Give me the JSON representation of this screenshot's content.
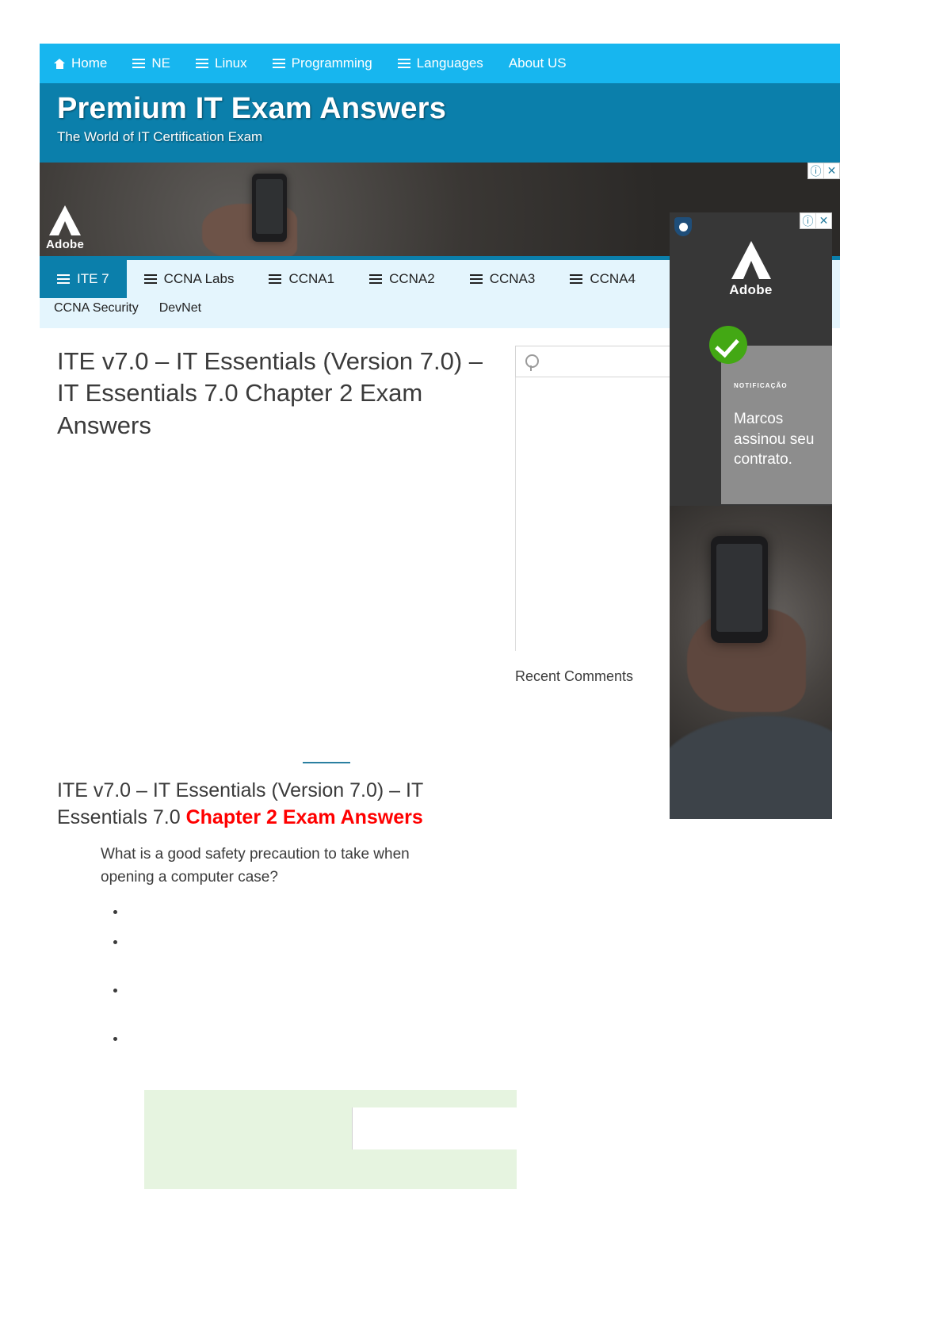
{
  "topnav": {
    "items": [
      {
        "label": "Home",
        "icon": "home-icon"
      },
      {
        "label": "NE",
        "icon": "hamburger-icon"
      },
      {
        "label": "Linux",
        "icon": "hamburger-icon"
      },
      {
        "label": "Programming",
        "icon": "hamburger-icon"
      },
      {
        "label": "Languages",
        "icon": "hamburger-icon"
      },
      {
        "label": "About US",
        "icon": "none"
      }
    ]
  },
  "header": {
    "title": "Premium IT Exam Answers",
    "tagline": "The World of IT Certification Exam"
  },
  "ads": {
    "leaderboard": {
      "brand": "Adobe",
      "info_icon": "ⓘ",
      "close_icon": "✕"
    },
    "square": {
      "brand": "Adobe",
      "info_icon": "ⓘ",
      "close_icon": "✕",
      "notification_label": "NOTIFICAÇÃO",
      "notification_text": "Marcos assinou seu contrato."
    }
  },
  "coursenav": {
    "row1": [
      {
        "label": "ITE 7",
        "active": true
      },
      {
        "label": "CCNA Labs",
        "active": false
      },
      {
        "label": "CCNA1",
        "active": false
      },
      {
        "label": "CCNA2",
        "active": false
      },
      {
        "label": "CCNA3",
        "active": false
      },
      {
        "label": "CCNA4",
        "active": false
      }
    ],
    "row2": [
      {
        "label": "CCNA Security"
      },
      {
        "label": "DevNet"
      }
    ]
  },
  "article": {
    "post_title": "ITE v7.0 – IT Essentials (Version 7.0) – IT Essentials 7.0 Chapter 2 Exam Answers",
    "entry_heading_plain": "ITE v7.0 – IT Essentials (Version 7.0) – IT Essentials 7.0 ",
    "entry_heading_highlight": "Chapter 2 Exam Answers",
    "question": "What is a good safety precaution to take when opening a computer case?",
    "answers": [
      "",
      "",
      "",
      ""
    ]
  },
  "sidebar": {
    "search_value": "",
    "search_placeholder": "",
    "recent_comments_title": "Recent Comments"
  },
  "colors": {
    "topnav": "#17b6ef",
    "header": "#0b7fab",
    "coursenav_bg": "#e4f5fd",
    "accent": "#0b7fab",
    "highlight_red": "#ff0000",
    "explain_green": "#e6f4e0",
    "check_green": "#43a814"
  }
}
